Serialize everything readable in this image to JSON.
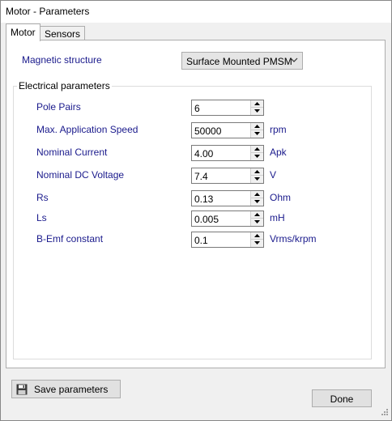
{
  "window": {
    "title": "Motor - Parameters"
  },
  "tabs": [
    {
      "label": "Motor",
      "active": true
    },
    {
      "label": "Sensors",
      "active": false
    }
  ],
  "magnetic": {
    "label": "Magnetic structure",
    "value": "Surface Mounted PMSM"
  },
  "electrical": {
    "legend": "Electrical parameters",
    "params": [
      {
        "label": "Pole Pairs",
        "value": "6",
        "unit": ""
      },
      {
        "label": "Max. Application Speed",
        "value": "50000",
        "unit": "rpm"
      },
      {
        "label": "Nominal Current",
        "value": "4.00",
        "unit": "Apk"
      },
      {
        "label": "Nominal DC Voltage",
        "value": "7.4",
        "unit": "V"
      },
      {
        "label": "Rs",
        "value": "0.13",
        "unit": "Ohm"
      },
      {
        "label": "Ls",
        "value": "0.005",
        "unit": "mH"
      },
      {
        "label": "B-Emf constant",
        "value": "0.1",
        "unit": "Vrms/krpm"
      }
    ]
  },
  "buttons": {
    "save": "Save parameters",
    "done": "Done"
  },
  "icons": {
    "save": "floppy-disk-icon",
    "spin_up": "triangle-up-icon",
    "spin_down": "triangle-down-icon",
    "combo": "chevron-down-icon",
    "grip": "resize-grip-icon"
  }
}
